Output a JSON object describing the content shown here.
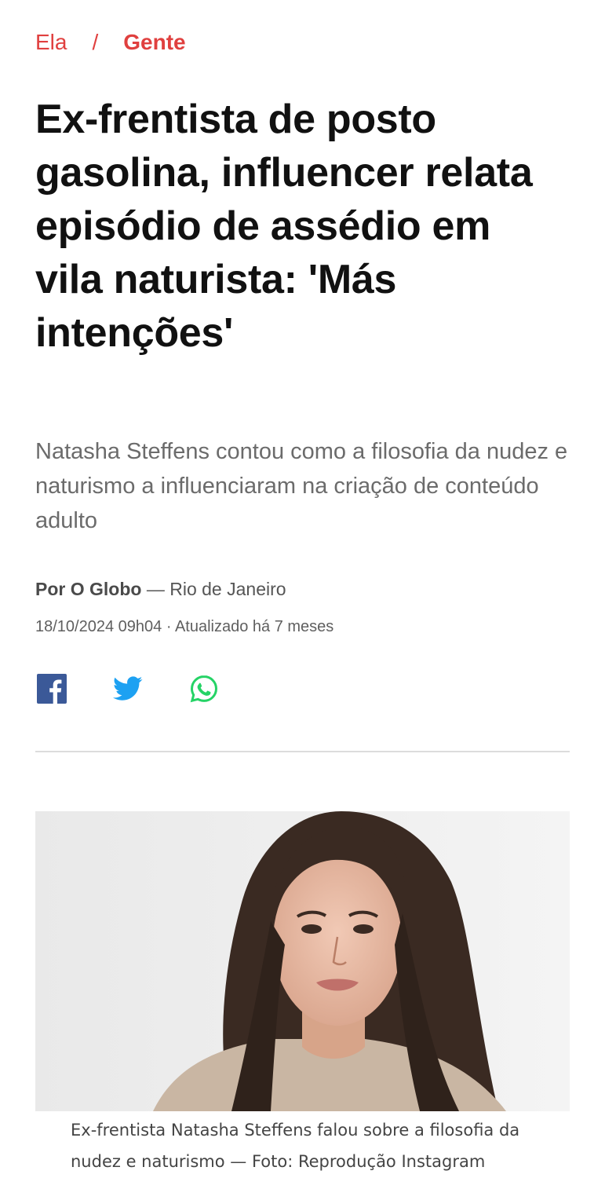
{
  "breadcrumb": {
    "section": "Ela",
    "separator": "/",
    "subsection": "Gente"
  },
  "article": {
    "headline": "Ex-frentista de posto gasolina, influencer relata episódio de assédio em vila naturista: 'Más intenções'",
    "subtitle": "Natasha Steffens contou como a filosofia da nudez e naturismo a influenciaram na criação de conteúdo adulto",
    "author": "Por O Globo",
    "location": "— Rio de Janeiro",
    "dateline": "18/10/2024 09h04 · Atualizado há 7 meses"
  },
  "share": {
    "icons": [
      "facebook-icon",
      "twitter-icon",
      "whatsapp-icon"
    ],
    "colors": {
      "facebook": "#3b5998",
      "twitter": "#1da1f2",
      "whatsapp": "#25d366"
    }
  },
  "photo": {
    "caption": "Ex-frentista Natasha Steffens falou sobre a filosofia da nudez e naturismo — Foto: Reprodução Instagram"
  },
  "colors": {
    "accent": "#e0403f",
    "subtitle_text": "#6b6b6b",
    "divider": "#dcdcdc"
  }
}
